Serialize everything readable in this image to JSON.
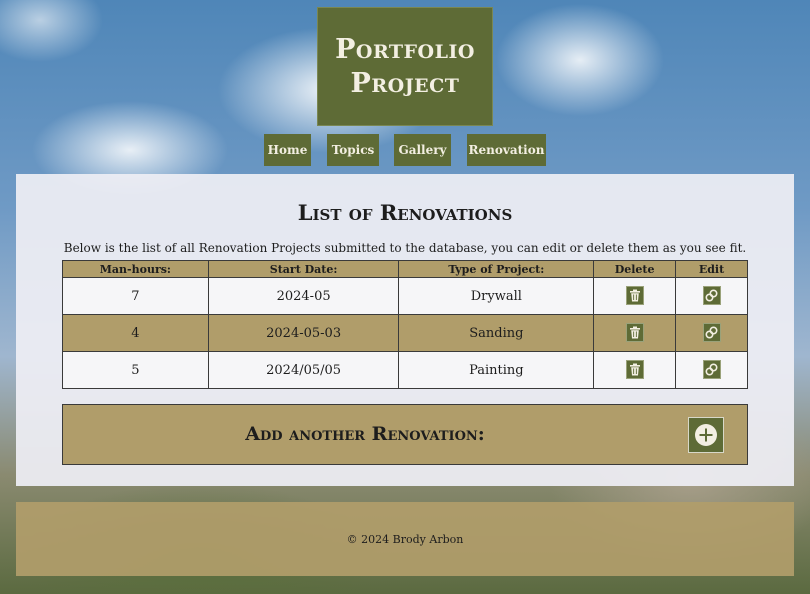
{
  "header": {
    "title_line1": "Portfolio",
    "title_line2": "Project"
  },
  "nav": {
    "items": [
      "Home",
      "Topics",
      "Gallery",
      "Renovation"
    ]
  },
  "main": {
    "title": "List of Renovations",
    "intro": "Below is the list of all Renovation Projects submitted to the database, you can edit or delete them as you see fit.",
    "columns": [
      "Man-hours:",
      "Start Date:",
      "Type of Project:",
      "Delete",
      "Edit"
    ],
    "rows": [
      {
        "hours": "7",
        "start": "2024-05",
        "type": "Drywall"
      },
      {
        "hours": "4",
        "start": "2024-05-03",
        "type": "Sanding"
      },
      {
        "hours": "5",
        "start": "2024/05/05",
        "type": "Painting"
      }
    ],
    "add_label": "Add another Renovation:"
  },
  "footer": {
    "text": "© 2024 Brody Arbon"
  },
  "colors": {
    "olive": "#5e6b36",
    "tan": "#b09d6a",
    "panel": "#eeeef4"
  },
  "icons": {
    "delete": "trash-icon",
    "edit": "edit-link-icon",
    "add": "plus-circle-icon"
  }
}
